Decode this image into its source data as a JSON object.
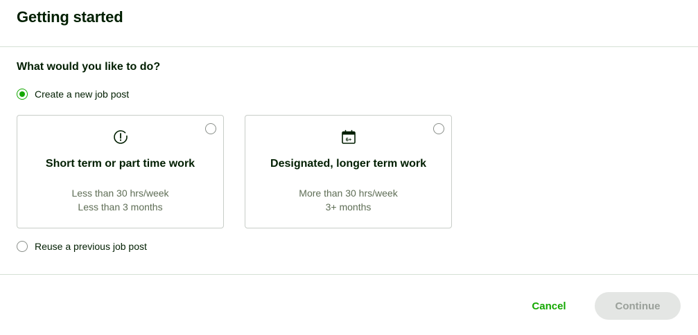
{
  "header": {
    "title": "Getting started"
  },
  "form": {
    "question": "What would you like to do?",
    "options": {
      "create": {
        "label": "Create a new job post",
        "selected": true
      },
      "reuse": {
        "label": "Reuse a previous job post",
        "selected": false
      }
    },
    "cards": [
      {
        "icon": "clock-alert-icon",
        "title": "Short term or part time work",
        "line1": "Less than 30 hrs/week",
        "line2": "Less than 3 months",
        "selected": false
      },
      {
        "icon": "calendar-6plus-icon",
        "icon_text": "6+",
        "title": "Designated, longer term work",
        "line1": "More than 30 hrs/week",
        "line2": "3+ months",
        "selected": false
      }
    ]
  },
  "footer": {
    "cancel_label": "Cancel",
    "continue_label": "Continue",
    "continue_disabled": true
  },
  "colors": {
    "accent": "#14a800",
    "text": "#001e00",
    "muted_text": "#5e6d55",
    "disabled_bg": "#e4e6e4",
    "disabled_text": "#9aa09a"
  }
}
